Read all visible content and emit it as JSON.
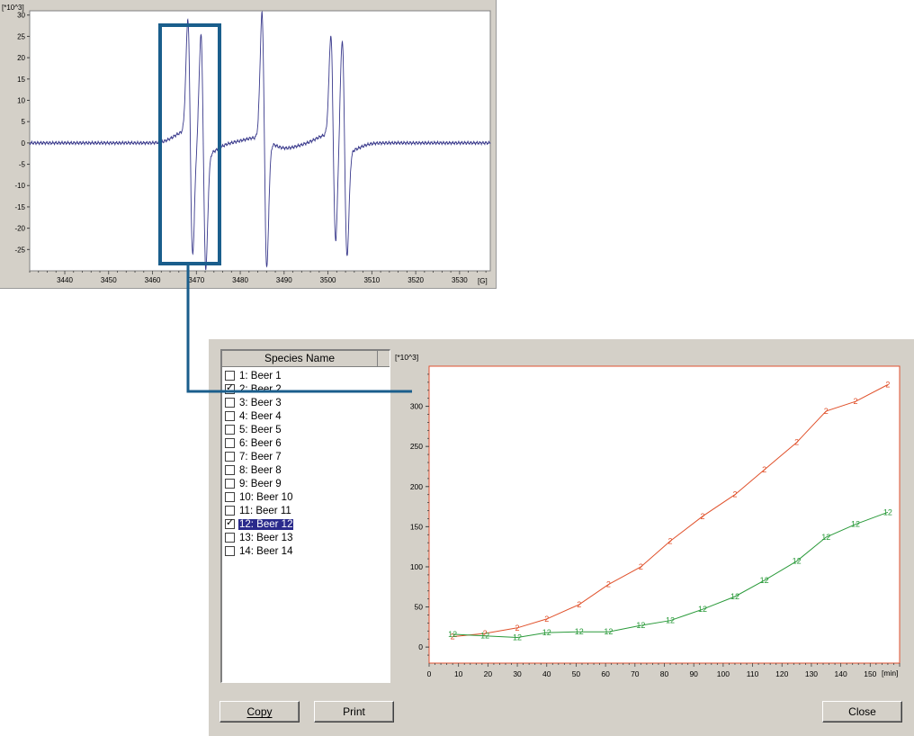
{
  "spectrum": {
    "ylabel": "[*10^3]",
    "xunit": "[G]",
    "x_ticks": [
      "3440",
      "3450",
      "3460",
      "3470",
      "3480",
      "3490",
      "3500",
      "3510",
      "3520",
      "3530"
    ],
    "y_ticks": [
      "30",
      "25",
      "20",
      "15",
      "10",
      "5",
      "0",
      "-5",
      "-10",
      "-15",
      "-20",
      "-25"
    ],
    "line_color": "#3a3a8c"
  },
  "species_list": {
    "header": "Species Name",
    "items": [
      {
        "num": "1:",
        "label": "Beer 1",
        "checked": false,
        "selected": false
      },
      {
        "num": "2:",
        "label": "Beer 2",
        "checked": true,
        "selected": false
      },
      {
        "num": "3:",
        "label": "Beer 3",
        "checked": false,
        "selected": false
      },
      {
        "num": "4:",
        "label": "Beer 4",
        "checked": false,
        "selected": false
      },
      {
        "num": "5:",
        "label": "Beer 5",
        "checked": false,
        "selected": false
      },
      {
        "num": "6:",
        "label": "Beer 6",
        "checked": false,
        "selected": false
      },
      {
        "num": "7:",
        "label": "Beer 7",
        "checked": false,
        "selected": false
      },
      {
        "num": "8:",
        "label": "Beer 8",
        "checked": false,
        "selected": false
      },
      {
        "num": "9:",
        "label": "Beer 9",
        "checked": false,
        "selected": false
      },
      {
        "num": "10:",
        "label": "Beer 10",
        "checked": false,
        "selected": false
      },
      {
        "num": "11:",
        "label": "Beer 11",
        "checked": false,
        "selected": false
      },
      {
        "num": "12:",
        "label": "Beer 12",
        "checked": true,
        "selected": true
      },
      {
        "num": "13:",
        "label": "Beer 13",
        "checked": false,
        "selected": false
      },
      {
        "num": "14:",
        "label": "Beer 14",
        "checked": false,
        "selected": false
      }
    ]
  },
  "buttons": {
    "copy": "Copy",
    "print": "Print",
    "close": "Close"
  },
  "chart_data": {
    "type": "line",
    "ylabel": "[*10^3]",
    "xlabel": "[min]",
    "xlim": [
      0,
      160
    ],
    "ylim": [
      -20,
      350
    ],
    "x_ticks": [
      "0",
      "10",
      "20",
      "30",
      "40",
      "50",
      "60",
      "70",
      "80",
      "90",
      "100",
      "110",
      "120",
      "130",
      "140",
      "150"
    ],
    "y_ticks": [
      "0",
      "50",
      "100",
      "150",
      "200",
      "250",
      "300"
    ],
    "series": [
      {
        "name": "2",
        "color": "#e0502a",
        "x": [
          8,
          19,
          30,
          40,
          51,
          61,
          72,
          82,
          93,
          104,
          114,
          125,
          135,
          145,
          156
        ],
        "y": [
          13,
          17,
          24,
          35,
          53,
          78,
          100,
          132,
          163,
          190,
          221,
          255,
          294,
          306,
          327
        ]
      },
      {
        "name": "12",
        "color": "#2a9a3a",
        "x": [
          8,
          19,
          30,
          40,
          51,
          61,
          72,
          82,
          93,
          104,
          114,
          125,
          135,
          145,
          156
        ],
        "y": [
          16,
          14,
          12,
          18,
          19,
          19,
          27,
          33,
          47,
          63,
          83,
          107,
          137,
          153,
          168
        ]
      }
    ]
  },
  "overlay": {
    "color": "#1a5e8c"
  }
}
